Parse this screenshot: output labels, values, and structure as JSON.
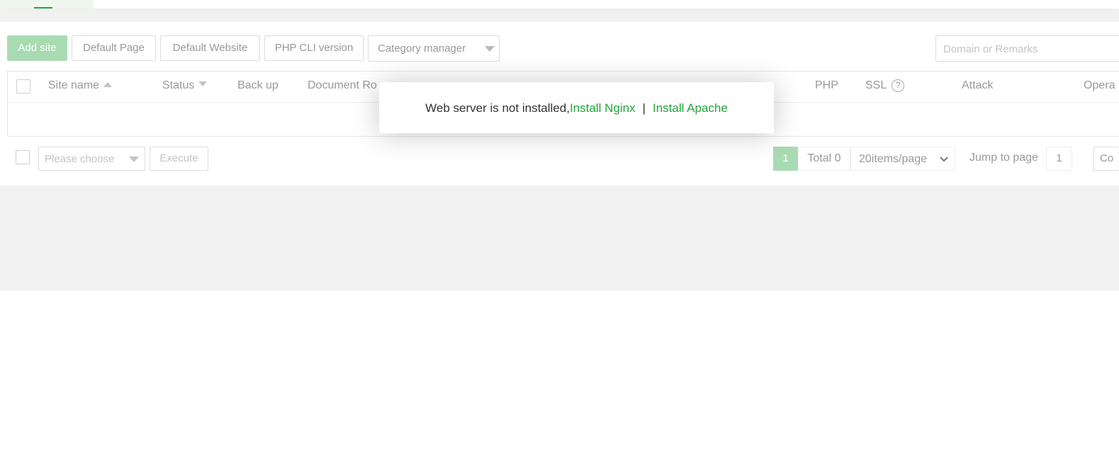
{
  "toolbar": {
    "add_site": "Add site",
    "default_page": "Default Page",
    "default_website": "Default Website",
    "php_cli_version": "PHP CLI version",
    "category_manager": "Category manager",
    "search_placeholder": "Domain or Remarks"
  },
  "table": {
    "columns": [
      "Site name",
      "Status",
      "Back up",
      "Document Ro",
      "PHP",
      "SSL",
      "Attack",
      "Opera"
    ],
    "ssl_help_icon": "?",
    "rows": []
  },
  "footer": {
    "batch_placeholder": "Please choose",
    "execute": "Execute",
    "current_page": "1",
    "total": "Total 0",
    "page_size": "20items/page",
    "jump_label": "Jump to page",
    "jump_value": "1",
    "confirm_partial": "Co"
  },
  "modal": {
    "message": "Web server is not installed,",
    "install_nginx": "Install Nginx",
    "separator": "|",
    "install_apache": "Install Apache"
  },
  "colors": {
    "accent": "#20a53a",
    "accent_light": "#a8dbb1",
    "background_gray": "#f1f1f1"
  },
  "icons": [
    "sort-asc-icon",
    "sort-desc-icon",
    "help-circle-icon",
    "chevron-down-icon"
  ]
}
